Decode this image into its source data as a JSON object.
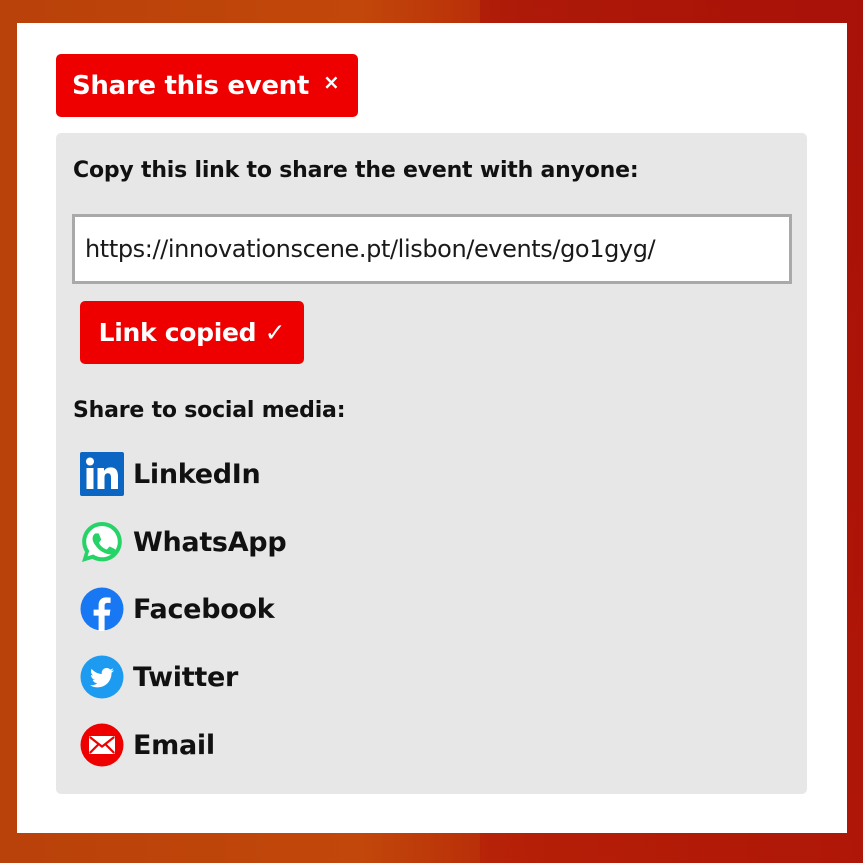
{
  "dialog": {
    "title": "Share this event",
    "close_glyph": "×",
    "copy_prompt": "Copy this link to share the event with anyone:",
    "link_value": "https://innovationscene.pt/lisbon/events/go1gyg/",
    "copy_button_label": "Link copied ✓",
    "social_prompt": "Share to social media:",
    "social_items": [
      {
        "label": "LinkedIn",
        "icon": "linkedin-icon",
        "color": "#0a66c2"
      },
      {
        "label": "WhatsApp",
        "icon": "whatsapp-icon",
        "color": "#25d366"
      },
      {
        "label": "Facebook",
        "icon": "facebook-icon",
        "color": "#1877f2"
      },
      {
        "label": "Twitter",
        "icon": "twitter-icon",
        "color": "#1d9bf0"
      },
      {
        "label": "Email",
        "icon": "email-icon",
        "color": "#ee0000"
      }
    ]
  },
  "colors": {
    "accent": "#ee0000",
    "panel_background": "#e7e7e7",
    "page_background": "#c2470a"
  }
}
